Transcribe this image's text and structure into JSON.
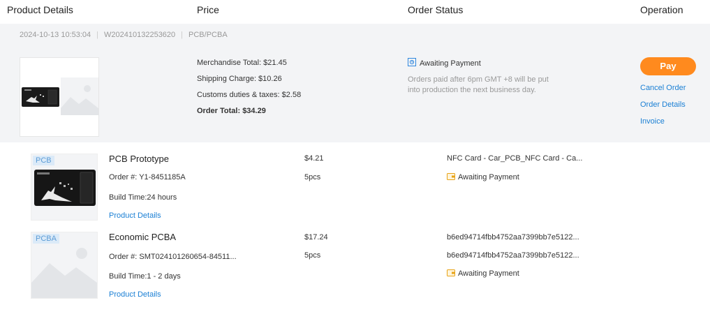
{
  "header": {
    "product_details": "Product Details",
    "price": "Price",
    "order_status": "Order Status",
    "operation": "Operation"
  },
  "order": {
    "datetime": "2024-10-13 10:53:04",
    "order_no": "W202410132253620",
    "type": "PCB/PCBA",
    "merchandise_total": "Merchandise Total: $21.45",
    "shipping_charge": "Shipping Charge: $10.26",
    "customs": "Customs duties & taxes: $2.58",
    "order_total": "Order Total: $34.29",
    "status": "Awaiting Payment",
    "status_note": "Orders paid after 6pm GMT +8 will be put into production the next business day.",
    "operations": {
      "pay": "Pay",
      "cancel": "Cancel Order",
      "details": "Order Details",
      "invoice": "Invoice"
    }
  },
  "items": [
    {
      "tag": "PCB",
      "title": "PCB Prototype",
      "order_no": "Order #: Y1-8451185A",
      "build_time": "Build Time:24 hours",
      "link": "Product Details",
      "price": "$4.21",
      "qty": "5pcs",
      "name": "NFC Card - Car_PCB_NFC Card - Ca...",
      "status": "Awaiting Payment"
    },
    {
      "tag": "PCBA",
      "title": "Economic PCBA",
      "order_no": "Order #: SMT024101260654-84511...",
      "build_time": "Build Time:1 - 2 days",
      "link": "Product Details",
      "price": "$17.24",
      "qty": "5pcs",
      "name": "b6ed94714fbb4752aa7399bb7e5122...",
      "name2": "b6ed94714fbb4752aa7399bb7e5122...",
      "status": "Awaiting Payment"
    }
  ],
  "colors": {
    "accent": "#ff8a1e",
    "link": "#1a7fd4",
    "summary_bg": "#f3f4f6"
  },
  "icons": {
    "order_status": "hourglass-document-icon",
    "item_status": "wallet-icon",
    "placeholder": "image-placeholder-icon"
  }
}
